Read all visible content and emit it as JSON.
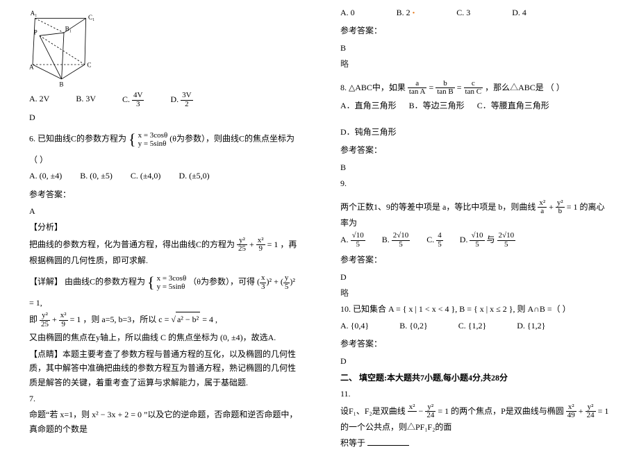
{
  "left": {
    "prism_labels": {
      "A1": "A₁",
      "B1": "B₁",
      "C1": "C₁",
      "A": "A",
      "B": "B",
      "C": "C",
      "P": "P"
    },
    "q5_options": {
      "a": "A. 2V",
      "b": "B. 3V",
      "c_prefix": "C.",
      "c_num": "4V",
      "c_den": "3",
      "d_prefix": "D.",
      "d_num": "3V",
      "d_den": "2"
    },
    "q5_answer_label": "D",
    "q6_num": "6.",
    "q6_text_1": "已知曲线C的参数方程为",
    "q6_param_top": "x = 3cosθ",
    "q6_param_bot": "y = 5sinθ",
    "q6_text_2": "(θ为参数），则曲线C的焦点坐标为（    ）",
    "q6_options": {
      "a": "A. (0, ±4)",
      "b": "B. (0, ±5)",
      "c": "C. (±4,0)",
      "d": "D. (±5,0)"
    },
    "q6_answer_tag": "参考答案：",
    "q6_answer": "A",
    "q6_analysis_tag": "【分析】",
    "q6_analysis_1": "把曲线的参数方程，化为普通方程，得出曲线C的方程为",
    "q6_eq1_a": "y²",
    "q6_eq1_b": "25",
    "q6_eq1_c": "x²",
    "q6_eq1_d": "9",
    "q6_eq1_e": "= 1",
    "q6_analysis_2": "，再根据椭圆的几何性质，即可求解.",
    "q6_detail_tag": "【详解】",
    "q6_detail_1": "由曲线C的参数方程为",
    "q6_detail_2": "（θ为参数），可得",
    "q6_r1_a": "x",
    "q6_r1_b": "3",
    "q6_r1_c": "y",
    "q6_r1_d": "5",
    "q6_r1_e": "= 1",
    "q6_line2_a": "即",
    "q6_line2_b": "，则 a=5, b=3，所以 c =",
    "q6_line2_c": "= 4 ,",
    "q6_sqrt": "a² − b²",
    "q6_line3": "又由椭圆的焦点在y轴上，所以曲线 C 的焦点坐标为 (0, ±4)，故选A.",
    "q6_dianjing_tag": "【点睛】",
    "q6_dianjing": "本题主要考查了参数方程与普通方程的互化，以及椭圆的几何性质，其中解答中准确把曲线的参数方程互为普通方程，熟记椭圆的几何性质是解答的关键，着重考查了运算与求解能力，属于基础题.",
    "q7_num": "7.",
    "q7_text": "命题“若 x=1，则 x² − 3x + 2 = 0 ”以及它的逆命题，否命题和逆否命题中，真命题的个数是"
  },
  "right": {
    "q7_options": {
      "a": "A.  0",
      "b": "B.  2",
      "c": "C.  3",
      "d": "D.  4"
    },
    "q7_dot": "•",
    "q7_answer_tag": "参考答案：",
    "q7_answer": "B",
    "q7_note": "略",
    "q8_num": "8.",
    "q8_text_1": "△ABC中，如果",
    "q8_f1_a": "a",
    "q8_f1_b": "tan A",
    "q8_f2_a": "b",
    "q8_f2_b": "tan B",
    "q8_f3_a": "c",
    "q8_f3_b": "tan C",
    "q8_text_2": "，那么△ABC是        （    ）",
    "q8_options": {
      "a": "A．直角三角形",
      "b": "B．等边三角形",
      "c": "C．等腰直角三角形",
      "d": "D．钝角三角形"
    },
    "q8_answer_tag": "参考答案：",
    "q8_answer": "B",
    "q9_num": "9.",
    "q9_text_1": "两个正数1、9的等差中项是 a，等比中项是 b，则曲线",
    "q9_f1_a": "x²",
    "q9_f1_b": "a",
    "q9_f2_a": "y²",
    "q9_f2_b": "b",
    "q9_eq": "= 1",
    "q9_text_2": "的离心率为",
    "q9_optA_prefix": "A.",
    "q9_optA_num": "√10",
    "q9_optA_den": "5",
    "q9_optB_prefix": "B.",
    "q9_optB_num": "2√10",
    "q9_optB_den": "5",
    "q9_optC_prefix": "C.",
    "q9_optC_num": "4",
    "q9_optC_den": "5",
    "q9_optD_prefix": "D.",
    "q9_optD_num1": "√10",
    "q9_optD_den1": "5",
    "q9_optD_join": "与",
    "q9_optD_num2": "2√10",
    "q9_optD_den2": "5",
    "q9_answer_tag": "参考答案：",
    "q9_answer": "D",
    "q9_note": "略",
    "q10_num": "10.",
    "q10_text": "已知集合 A = { x | 1 < x < 4 }, B = { x | x ≤ 2 }, 则 A∩B =（        ）",
    "q10_options": {
      "a": "A.  {0,4}",
      "b": "B.  {0,2}",
      "c": "C.  {1,2}",
      "d": "D.  {1,2}"
    },
    "q10_answer_tag": "参考答案：",
    "q10_answer": "D",
    "section2": "二、 填空题:本大题共7小题,每小题4分,共28分",
    "q11_num": "11.",
    "q11_text_1": "设F₁、F₂是双曲线",
    "q11_f1_a": "x²",
    "q11_f1_b": "",
    "q11_sep": "−",
    "q11_f2_a": "y²",
    "q11_f2_b": "24",
    "q11_eq": "= 1",
    "q11_text_2": "的两个焦点，P是双曲线与椭圆",
    "q11_f3_a": "x²",
    "q11_f3_b": "49",
    "q11_f4_a": "y²",
    "q11_f4_b": "24",
    "q11_eq2": "= 1",
    "q11_text_3": "的一个公共点，则△PF₁F₂的面",
    "q11_text_4": "积等于"
  }
}
